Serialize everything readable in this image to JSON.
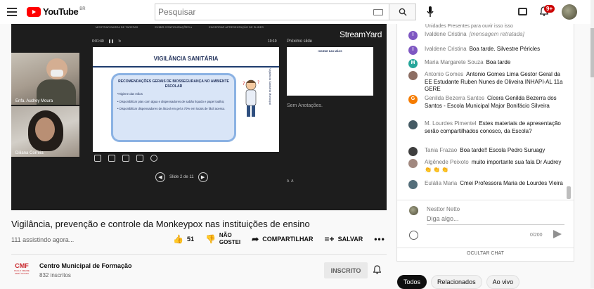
{
  "header": {
    "logo_text": "YouTube",
    "logo_region": "BR",
    "search_placeholder": "Pesquisar",
    "notification_count": "9+"
  },
  "player": {
    "speaker_1": "Enfa. Audrey Moura",
    "speaker_2": "Diliana Correia",
    "streamyard": "StreamYard",
    "toolbar": [
      "MOSTRAR BARRA DE TAREFAS",
      "EXIBIR CONFIGURAÇÕES ▾",
      "ENCERRAR APRESENTAÇÃO DE SLIDES"
    ],
    "timer": "0:01:40",
    "timer_end": "10:10",
    "next_slide_label": "Próximo slide",
    "notes_label": "Sem Anotações.",
    "slide_counter": "Slide 2 de 11",
    "slide": {
      "title": "VIGILÂNCIA SANITÁRIA",
      "box_heading": "RECOMENDAÇÕES GERAIS DE BIOSSEGURANÇA NO AMBIENTE ESCOLAR",
      "line_1": "•Higiene das mãos",
      "line_2": "• Disponibilizar pias com água e dispensadores de sabão líquido e papel toalha;",
      "line_3": "• Disponibilizar dispensadores de álcool em gel a 70% em locais de fácil acesso.",
      "side_text": "Vigilância Sanitária Municipal"
    },
    "next_slide": {
      "title": "HIGIENE DAS MÃOS"
    }
  },
  "video": {
    "title": "Vigilância, prevenção e controle da Monkeypox nas instituições de ensino",
    "views": "111 assistindo agora...",
    "likes": "51",
    "dislike_label_1": "NÃO",
    "dislike_label_2": "GOSTEI",
    "share_label": "COMPARTILHAR",
    "save_label": "SALVAR",
    "more": "•••"
  },
  "channel": {
    "logo_big": "CMF",
    "logo_small": "PAULO FREIRE SERÁ NOSSO",
    "name": "Centro Municipal de Formação",
    "subscribers": "832 inscritos",
    "subscribe_label": "INSCRITO"
  },
  "chat": {
    "top_cut": "Unidades Presentes para ouvir isso isso",
    "messages": [
      {
        "initial": "I",
        "color": "#7e57c2",
        "author": "Ivaldene Cristina",
        "text": "[mensagem retratada]",
        "retracted": true
      },
      {
        "initial": "I",
        "color": "#7e57c2",
        "author": "Ivaldene Cristina",
        "text": "Boa tarde. Silvestre Péricles"
      },
      {
        "initial": "M",
        "color": "#26a69a",
        "author": "Maria Margarete Souza",
        "text": "Boa tarde"
      },
      {
        "initial": "",
        "color": "#8d6e63",
        "author": "Antonio Gomes",
        "text": "Antonio Gomes Lima Gestor Geral da EE Estudante Ruben Nunes de Oliveira INHAPI-AL 11a GERE"
      },
      {
        "initial": "G",
        "color": "#f57c00",
        "author": "Genilda Bezerra Santos",
        "text": "Cícera Genilda Bezerra dos Santos - Escola Municipal Major Bonifácio Silveira"
      },
      {
        "initial": "",
        "color": "#455a64",
        "author": "M. Lourdes Pimentel",
        "text": "Estes materiais de apresentação serão compartilhados conosco, da Escola?"
      },
      {
        "initial": "",
        "color": "#3e3e3e",
        "author": "Tania Frazao",
        "text": "Boa tarde!! Escola Pedro Suruagy"
      },
      {
        "initial": "",
        "color": "#a1887f",
        "author": "Algênede Peixoto",
        "text": "muito importante sua fala Dr Audrey 👏 👏 👏"
      },
      {
        "initial": "",
        "color": "#546e7a",
        "author": "Eulália Maria",
        "text": "Cmei Professora Maria de Lourdes Vieira"
      }
    ],
    "me_name": "Nesttor Netto",
    "input_placeholder": "Diga algo...",
    "counter": "0/200",
    "hide_label": "OCULTAR CHAT"
  },
  "chips": [
    "Todos",
    "Relacionados",
    "Ao vivo"
  ]
}
